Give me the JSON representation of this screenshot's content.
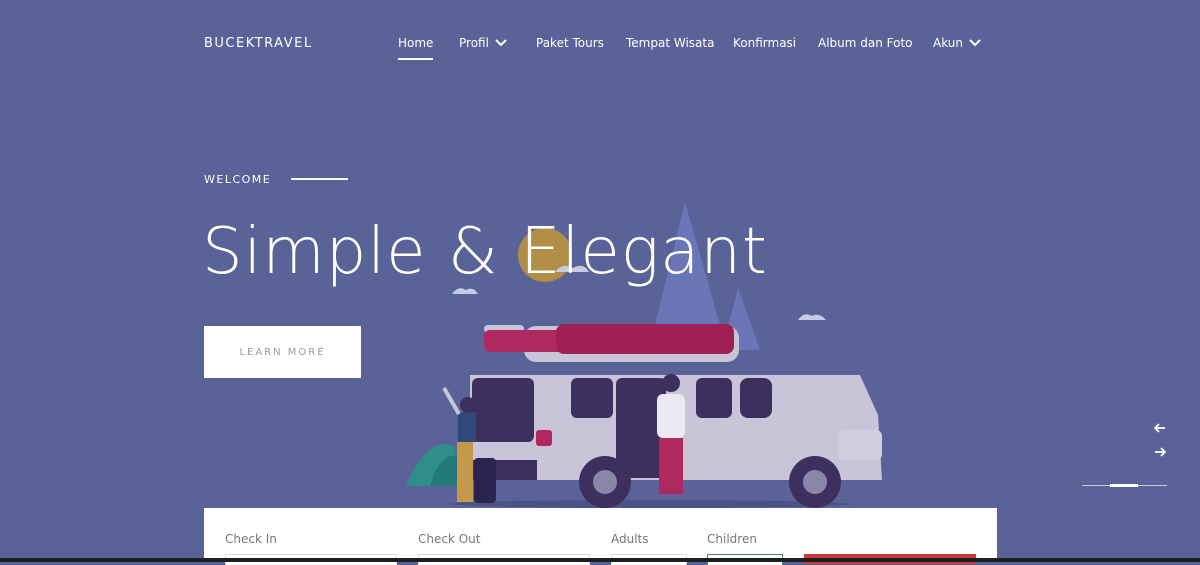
{
  "brand": "BUCEKTRAVEL",
  "nav": [
    {
      "label": "Home",
      "active": true
    },
    {
      "label": "Profil",
      "dropdown": true
    },
    {
      "label": "Paket Tours"
    },
    {
      "label": "Tempat Wisata"
    },
    {
      "label": "Konfirmasi"
    },
    {
      "label": "Album dan Foto"
    },
    {
      "label": "Akun",
      "dropdown": true
    }
  ],
  "hero": {
    "eyebrow": "WELCOME",
    "title": "Simple & Elegant",
    "cta": "LEARN MORE"
  },
  "booking": {
    "check_in_label": "Check In",
    "check_out_label": "Check Out",
    "adults_label": "Adults",
    "children_label": "Children"
  },
  "colors": {
    "background": "#5a6398",
    "accent_red": "#c63a3a",
    "car_roof": "#b0285f"
  }
}
